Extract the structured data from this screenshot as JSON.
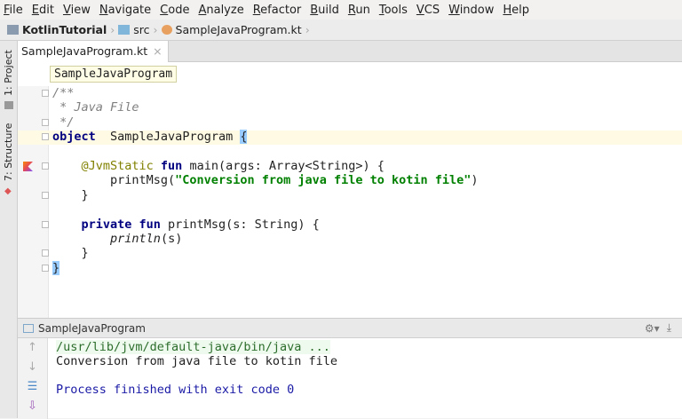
{
  "menu": [
    "File",
    "Edit",
    "View",
    "Navigate",
    "Code",
    "Analyze",
    "Refactor",
    "Build",
    "Run",
    "Tools",
    "VCS",
    "Window",
    "Help"
  ],
  "breadcrumb": {
    "project": "KotlinTutorial",
    "folder": "src",
    "file": "SampleJavaProgram.kt"
  },
  "side_tabs": {
    "project": "1: Project",
    "structure": "7: Structure"
  },
  "editor_tab": {
    "label": "SampleJavaProgram.kt",
    "close": "×"
  },
  "code_breadcrumb": "SampleJavaProgram",
  "code": [
    [
      [
        "cm",
        "/**"
      ]
    ],
    [
      [
        "cm",
        " * Java File"
      ]
    ],
    [
      [
        "cm",
        " */"
      ]
    ],
    [
      [
        "kw",
        "object"
      ],
      [
        "",
        "  SampleJavaProgram "
      ],
      [
        "br",
        "{"
      ]
    ],
    [],
    [
      [
        "",
        "    "
      ],
      [
        "ann",
        "@JvmStatic"
      ],
      [
        "",
        ""
      ],
      [
        "kw",
        " fun"
      ],
      [
        "",
        " main(args: Array<String>) {"
      ]
    ],
    [
      [
        "",
        "        printMsg("
      ],
      [
        "str",
        "\"Conversion from java file to kotin file\""
      ],
      [
        "",
        ")"
      ]
    ],
    [
      [
        "",
        "    }"
      ]
    ],
    [],
    [
      [
        "",
        "    "
      ],
      [
        "kw",
        "private fun"
      ],
      [
        "",
        " printMsg(s: String) {"
      ]
    ],
    [
      [
        "",
        "        "
      ],
      [
        "it",
        "println"
      ],
      [
        "",
        "(s)"
      ]
    ],
    [
      [
        "",
        "    }"
      ]
    ],
    [
      [
        "br",
        "}"
      ]
    ]
  ],
  "run": {
    "title": "SampleJavaProgram",
    "output": [
      "/usr/lib/jvm/default-java/bin/java ...",
      "Conversion from java file to kotin file",
      "",
      "Process finished with exit code 0"
    ]
  }
}
